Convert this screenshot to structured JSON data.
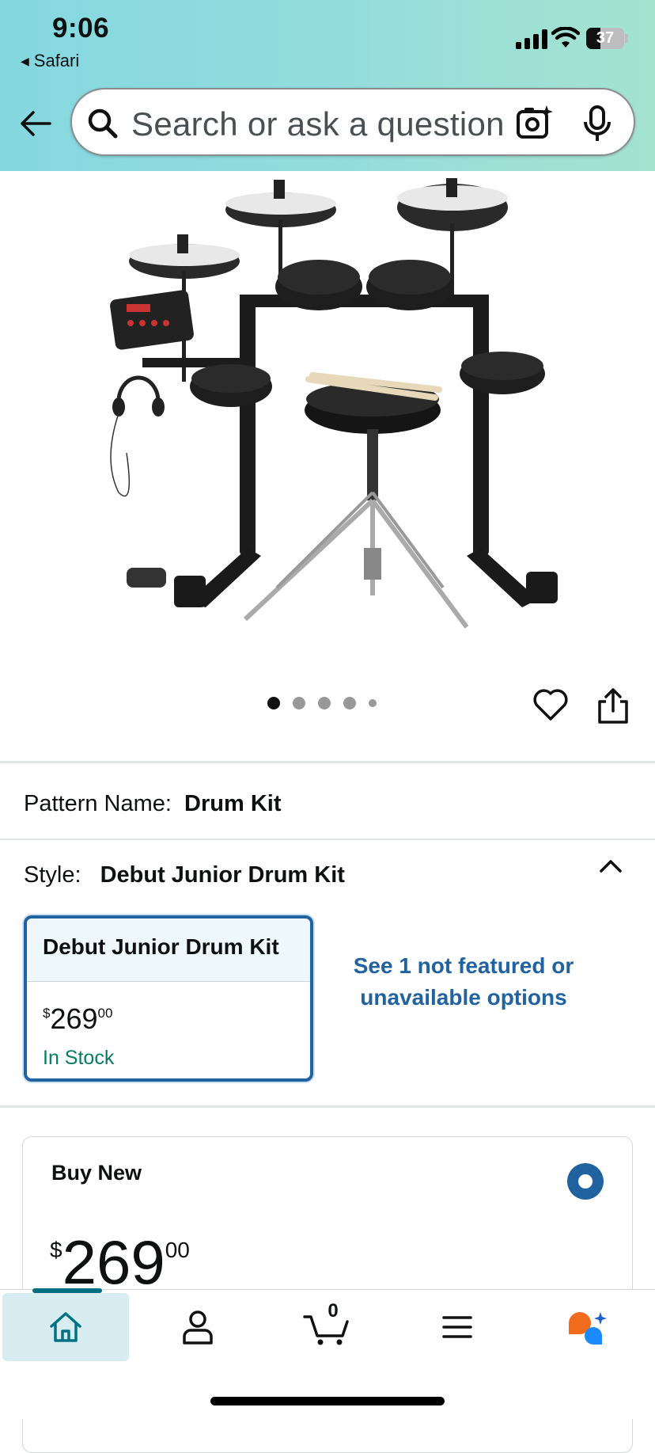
{
  "status_bar": {
    "time": "9:06",
    "back_app": "Safari",
    "battery": "37"
  },
  "search": {
    "placeholder": "Search or ask a question"
  },
  "gallery": {
    "image_alt": "Debut Junior Drum Kit product image",
    "dot_count": 5,
    "active_index": 0
  },
  "pattern": {
    "label": "Pattern Name:",
    "value": "Drum Kit"
  },
  "style": {
    "label": "Style:",
    "value": "Debut Junior Drum Kit",
    "option": {
      "name": "Debut Junior Drum Kit",
      "price_symbol": "$",
      "price_whole": "269",
      "price_fraction": "00",
      "availability": "In Stock"
    },
    "see_more": "See 1 not featured or unavailable options"
  },
  "buy_box": {
    "title": "Buy New",
    "price_symbol": "$",
    "price_whole": "269",
    "price_fraction": "00"
  },
  "tabbar": {
    "cart_count": "0",
    "active": "home"
  },
  "colors": {
    "accent_blue": "#2162a1",
    "in_stock_green": "#067d62",
    "header_gradient_start": "#85d8e0",
    "header_gradient_end": "#a5e3cf",
    "tab_active": "#007185"
  }
}
